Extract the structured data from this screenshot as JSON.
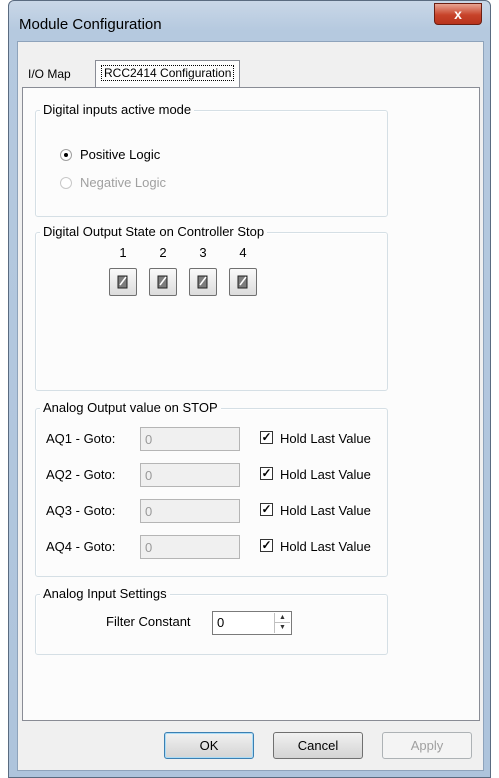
{
  "window": {
    "title": "Module Configuration",
    "close_glyph": "x"
  },
  "tabs": [
    {
      "label": "I/O Map",
      "active": false
    },
    {
      "label": "RCC2414 Configuration",
      "active": true
    }
  ],
  "digital_inputs": {
    "legend": "Digital inputs active mode",
    "options": [
      {
        "label": "Positive Logic",
        "selected": true,
        "enabled": true
      },
      {
        "label": "Negative Logic",
        "selected": false,
        "enabled": false
      }
    ]
  },
  "digital_output": {
    "legend": "Digital Output State on Controller Stop",
    "outputs": [
      {
        "label": "1",
        "icon": "switch-off-icon"
      },
      {
        "label": "2",
        "icon": "switch-off-icon"
      },
      {
        "label": "3",
        "icon": "switch-off-icon"
      },
      {
        "label": "4",
        "icon": "switch-off-icon"
      }
    ]
  },
  "analog_output": {
    "legend": "Analog Output value on STOP",
    "rows": [
      {
        "label": "AQ1 - Goto:",
        "value": "0",
        "checkbox_label": "Hold Last Value",
        "checked": true
      },
      {
        "label": "AQ2 - Goto:",
        "value": "0",
        "checkbox_label": "Hold Last Value",
        "checked": true
      },
      {
        "label": "AQ3 - Goto:",
        "value": "0",
        "checkbox_label": "Hold Last Value",
        "checked": true
      },
      {
        "label": "AQ4 - Goto:",
        "value": "0",
        "checkbox_label": "Hold Last Value",
        "checked": true
      }
    ]
  },
  "analog_input": {
    "legend": "Analog Input Settings",
    "filter_label": "Filter Constant",
    "filter_value": "0"
  },
  "buttons": {
    "ok": "OK",
    "cancel": "Cancel",
    "apply": "Apply"
  },
  "colors": {
    "title_bar": "#b5c9df",
    "close_button": "#c7432a",
    "disabled_text": "#a0a0a0"
  }
}
